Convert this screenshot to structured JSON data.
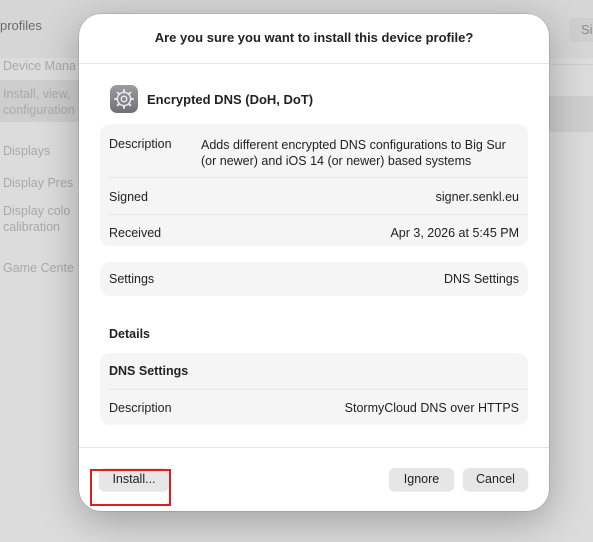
{
  "background": {
    "title": "profiles",
    "search_stub": "Si",
    "sidebar_items": [
      "Device Mana",
      "Install, view,",
      "configuration",
      "Displays",
      "Display Pres",
      "Display colo",
      "calibration",
      "Game Cente"
    ]
  },
  "dialog": {
    "title": "Are you sure you want to install this device profile?",
    "profile": {
      "icon": "gear-icon",
      "name": "Encrypted DNS (DoH, DoT)"
    },
    "info": {
      "description_label": "Description",
      "description_value": "Adds different encrypted DNS configurations to Big Sur (or newer) and iOS 14 (or newer) based systems",
      "signed_label": "Signed",
      "signed_value": "signer.senkl.eu",
      "received_label": "Received",
      "received_value": "Apr 3, 2026 at 5:45 PM"
    },
    "settings": {
      "label": "Settings",
      "value": "DNS Settings"
    },
    "details": {
      "heading": "Details",
      "card_title": "DNS Settings",
      "description_label": "Description",
      "description_value": "StormyCloud DNS over HTTPS"
    },
    "buttons": {
      "install": "Install...",
      "ignore": "Ignore",
      "cancel": "Cancel"
    },
    "highlight_color": "#e11d1d"
  }
}
